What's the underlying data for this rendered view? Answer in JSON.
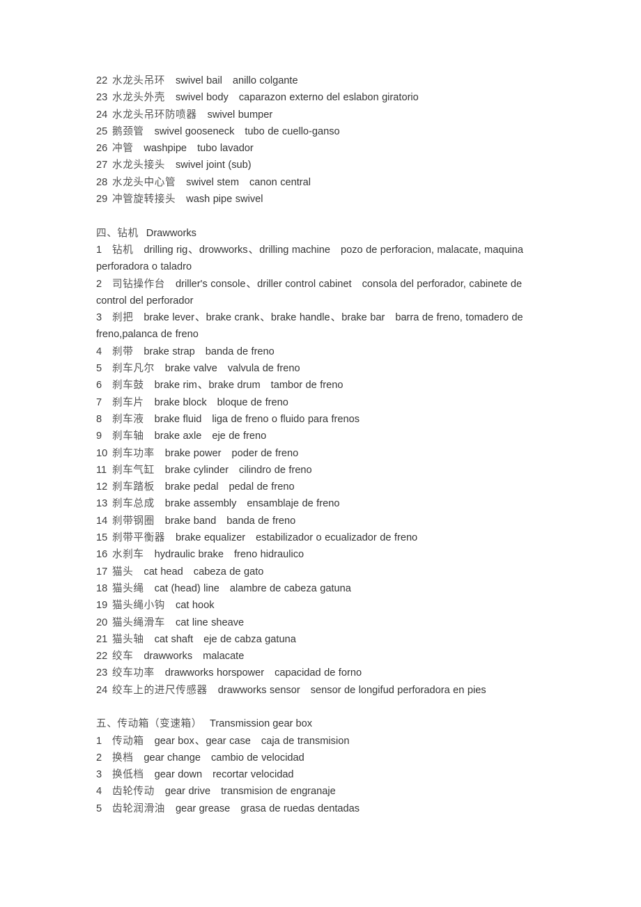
{
  "document": {
    "language_note": "Chinese-English-Spanish drilling equipment glossary",
    "blocks": [
      {
        "kind": "entries",
        "items": [
          {
            "num": "22",
            "cn": "水龙头吊环",
            "en": [
              "swivel bail"
            ],
            "es": "anillo colgante"
          },
          {
            "num": "23",
            "cn": "水龙头外壳",
            "en": [
              "swivel body"
            ],
            "es": "caparazon externo del eslabon giratorio"
          },
          {
            "num": "24",
            "cn": "水龙头吊环防喷器",
            "en": [
              "swivel bumper"
            ],
            "es": ""
          },
          {
            "num": "25",
            "cn": "鹅颈管",
            "en": [
              "swivel gooseneck"
            ],
            "es": "tubo de cuello-ganso"
          },
          {
            "num": "26",
            "cn": "冲管",
            "en": [
              "washpipe"
            ],
            "es": "tubo lavador"
          },
          {
            "num": "27",
            "cn": "水龙头接头",
            "en": [
              "swivel joint (sub)"
            ],
            "es": ""
          },
          {
            "num": "28",
            "cn": "水龙头中心管",
            "en": [
              "swivel stem"
            ],
            "es": "canon central"
          },
          {
            "num": "29",
            "cn": "冲管旋转接头",
            "en": [
              "wash pipe swivel"
            ],
            "es": ""
          }
        ]
      },
      {
        "kind": "spacer"
      },
      {
        "kind": "section",
        "cn": "四、钻机",
        "en": "Drawworks"
      },
      {
        "kind": "entries",
        "items": [
          {
            "num": "1",
            "cn": "钻机",
            "en": [
              "drilling rig",
              "drowworks",
              "drilling machine"
            ],
            "es": "pozo de perforacion, malacate, maquina perforadora o taladro"
          },
          {
            "num": "2",
            "cn": "司钻操作台",
            "en": [
              "driller's console",
              "driller control cabinet"
            ],
            "es": "consola del perforador, cabinete de control del perforador"
          },
          {
            "num": "3",
            "cn": "刹把",
            "en": [
              "brake lever",
              "brake crank",
              "brake handle",
              "brake bar"
            ],
            "es": "barra de freno, tomadero de freno,palanca de freno"
          },
          {
            "num": "4",
            "cn": "刹带",
            "en": [
              "brake strap"
            ],
            "es": "banda de freno"
          },
          {
            "num": "5",
            "cn": "刹车凡尔",
            "en": [
              "brake valve"
            ],
            "es": "valvula de freno"
          },
          {
            "num": "6",
            "cn": "刹车鼓",
            "en": [
              "brake rim",
              "brake drum"
            ],
            "es": "tambor de freno"
          },
          {
            "num": "7",
            "cn": "刹车片",
            "en": [
              "brake block"
            ],
            "es": "bloque de freno"
          },
          {
            "num": "8",
            "cn": "刹车液",
            "en": [
              "brake fluid"
            ],
            "es": "liga de freno o fluido para frenos"
          },
          {
            "num": "9",
            "cn": "刹车轴",
            "en": [
              "brake axle"
            ],
            "es": "eje de freno"
          },
          {
            "num": "10",
            "cn": "刹车功率",
            "en": [
              "brake power"
            ],
            "es": "poder de freno"
          },
          {
            "num": "11",
            "cn": "刹车气缸",
            "en": [
              "brake cylinder"
            ],
            "es": "cilindro de freno"
          },
          {
            "num": "12",
            "cn": "刹车踏板",
            "en": [
              "brake pedal"
            ],
            "es": "pedal de freno"
          },
          {
            "num": "13",
            "cn": "刹车总成",
            "en": [
              "brake assembly"
            ],
            "es": "ensamblaje de freno"
          },
          {
            "num": "14",
            "cn": "刹带钢圈",
            "en": [
              "brake band"
            ],
            "es": "banda de freno"
          },
          {
            "num": "15",
            "cn": "刹带平衡器",
            "en": [
              "brake equalizer"
            ],
            "es": "estabilizador o ecualizador de freno"
          },
          {
            "num": "16",
            "cn": "水刹车",
            "en": [
              "hydraulic brake"
            ],
            "es": "freno hidraulico"
          },
          {
            "num": "17",
            "cn": "猫头",
            "en": [
              "cat head"
            ],
            "es": "cabeza de gato"
          },
          {
            "num": "18",
            "cn": "猫头绳",
            "en": [
              "cat (head) line"
            ],
            "es": "alambre de cabeza gatuna"
          },
          {
            "num": "19",
            "cn": "猫头绳小钩",
            "en": [
              "cat hook"
            ],
            "es": ""
          },
          {
            "num": "20",
            "cn": "猫头绳滑车",
            "en": [
              "cat line sheave"
            ],
            "es": ""
          },
          {
            "num": "21",
            "cn": "猫头轴",
            "en": [
              "cat shaft"
            ],
            "es": "eje de cabza gatuna"
          },
          {
            "num": "22",
            "cn": "绞车",
            "en": [
              "drawworks"
            ],
            "es": "malacate"
          },
          {
            "num": "23",
            "cn": "绞车功率",
            "en": [
              "drawworks horspower"
            ],
            "es": "capacidad de forno"
          },
          {
            "num": "24",
            "cn": "绞车上的进尺传感器",
            "en": [
              "drawworks sensor"
            ],
            "es": "sensor de longifud perforadora en pies"
          }
        ]
      },
      {
        "kind": "spacer"
      },
      {
        "kind": "section",
        "cn": "五、传动箱（变速箱）",
        "en": "Transmission gear box"
      },
      {
        "kind": "entries",
        "items": [
          {
            "num": "1",
            "cn": "传动箱",
            "en": [
              "gear box",
              "gear case"
            ],
            "es": "caja de transmision"
          },
          {
            "num": "2",
            "cn": "换档",
            "en": [
              "gear change"
            ],
            "es": "cambio de velocidad"
          },
          {
            "num": "3",
            "cn": "换低档",
            "en": [
              "gear down"
            ],
            "es": "recortar velocidad"
          },
          {
            "num": "4",
            "cn": "齿轮传动",
            "en": [
              "gear drive"
            ],
            "es": "transmision de engranaje"
          },
          {
            "num": "5",
            "cn": "齿轮润滑油",
            "en": [
              "gear grease"
            ],
            "es": "grasa de ruedas dentadas"
          }
        ]
      }
    ],
    "separator_glyph": "、",
    "colors": {
      "page_background": "#ffffff",
      "latin_text": "#343434",
      "cjk_text": "#545454"
    }
  }
}
